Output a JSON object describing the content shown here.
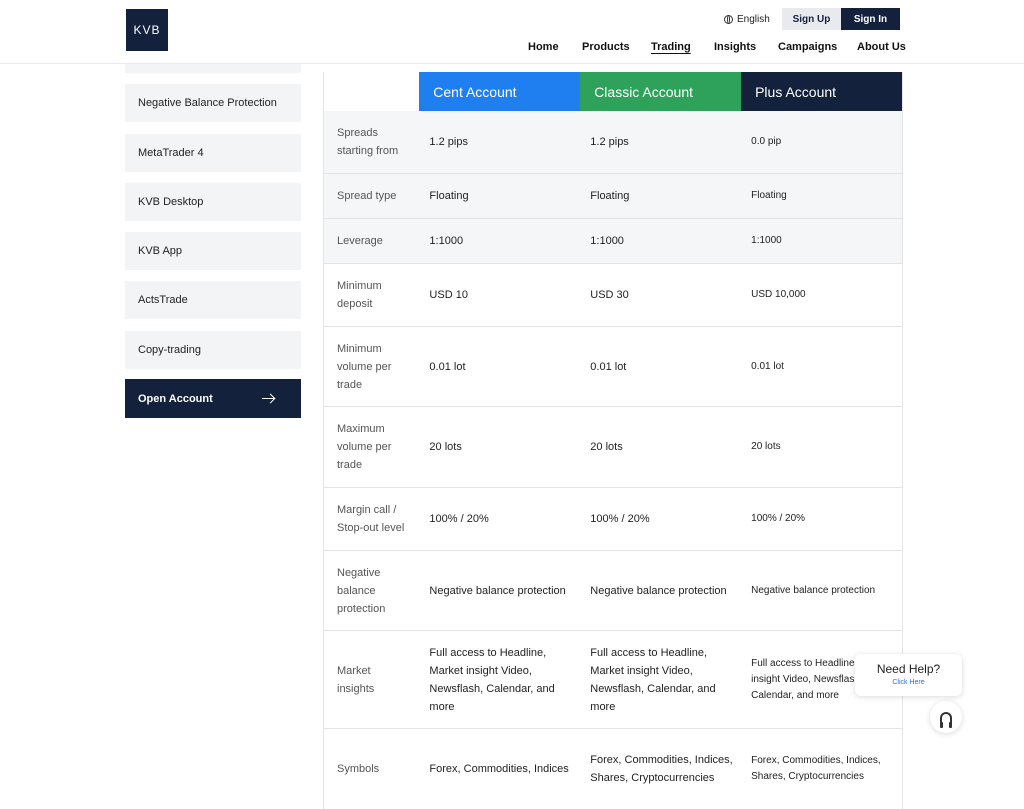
{
  "brand": {
    "logo_text": "KVB"
  },
  "header": {
    "language": "English",
    "signup_label": "Sign Up",
    "signin_label": "Sign In",
    "nav": [
      "Home",
      "Products",
      "Trading",
      "Insights",
      "Campaigns",
      "About Us"
    ],
    "active_nav": "Trading"
  },
  "sidebar": {
    "items": [
      "Negative Balance Protection",
      "MetaTrader 4",
      "KVB Desktop",
      "KVB App",
      "ActsTrade",
      "Copy-trading"
    ],
    "open_account_label": "Open Account"
  },
  "table": {
    "columns": [
      {
        "name": "Cent Account",
        "color": "#1f7ef0"
      },
      {
        "name": "Classic Account",
        "color": "#2ea25a"
      },
      {
        "name": "Plus Account",
        "color": "#14213d"
      }
    ],
    "rows": [
      {
        "label": "Spreads starting from",
        "cent": "1.2 pips",
        "classic": "1.2 pips",
        "plus": "0.0 pip"
      },
      {
        "label": "Spread type",
        "cent": "Floating",
        "classic": "Floating",
        "plus": "Floating"
      },
      {
        "label": "Leverage",
        "cent": "1:1000",
        "classic": "1:1000",
        "plus": "1:1000"
      },
      {
        "label": "Minimum deposit",
        "cent": "USD 10",
        "classic": "USD 30",
        "plus": "USD 10,000"
      },
      {
        "label": "Minimum volume per trade",
        "cent": "0.01 lot",
        "classic": "0.01 lot",
        "plus": "0.01 lot"
      },
      {
        "label": "Maximum volume per trade",
        "cent": "20 lots",
        "classic": "20 lots",
        "plus": "20 lots"
      },
      {
        "label": "Margin call / Stop-out level",
        "cent": "100% / 20%",
        "classic": "100% / 20%",
        "plus": "100% / 20%"
      },
      {
        "label": "Negative balance protection",
        "cent": "Negative balance protection",
        "classic": "Negative balance protection",
        "plus": "Negative balance protection"
      },
      {
        "label": "Market insights",
        "cent": "Full access to Headline, Market insight Video, Newsflash, Calendar, and more",
        "classic": "Full access to Headline, Market insight Video, Newsflash, Calendar, and more",
        "plus": "Full access to Headline, Market insight Video, Newsflash, Calendar, and more"
      },
      {
        "label": "Symbols",
        "cent": "Forex, Commodities, Indices",
        "classic": "Forex, Commodities, Indices, Shares, Cryptocurrencies",
        "plus": "Forex, Commodities, Indices, Shares, Cryptocurrencies"
      }
    ]
  },
  "help": {
    "title": "Need Help?",
    "subtitle": "Click Here"
  }
}
